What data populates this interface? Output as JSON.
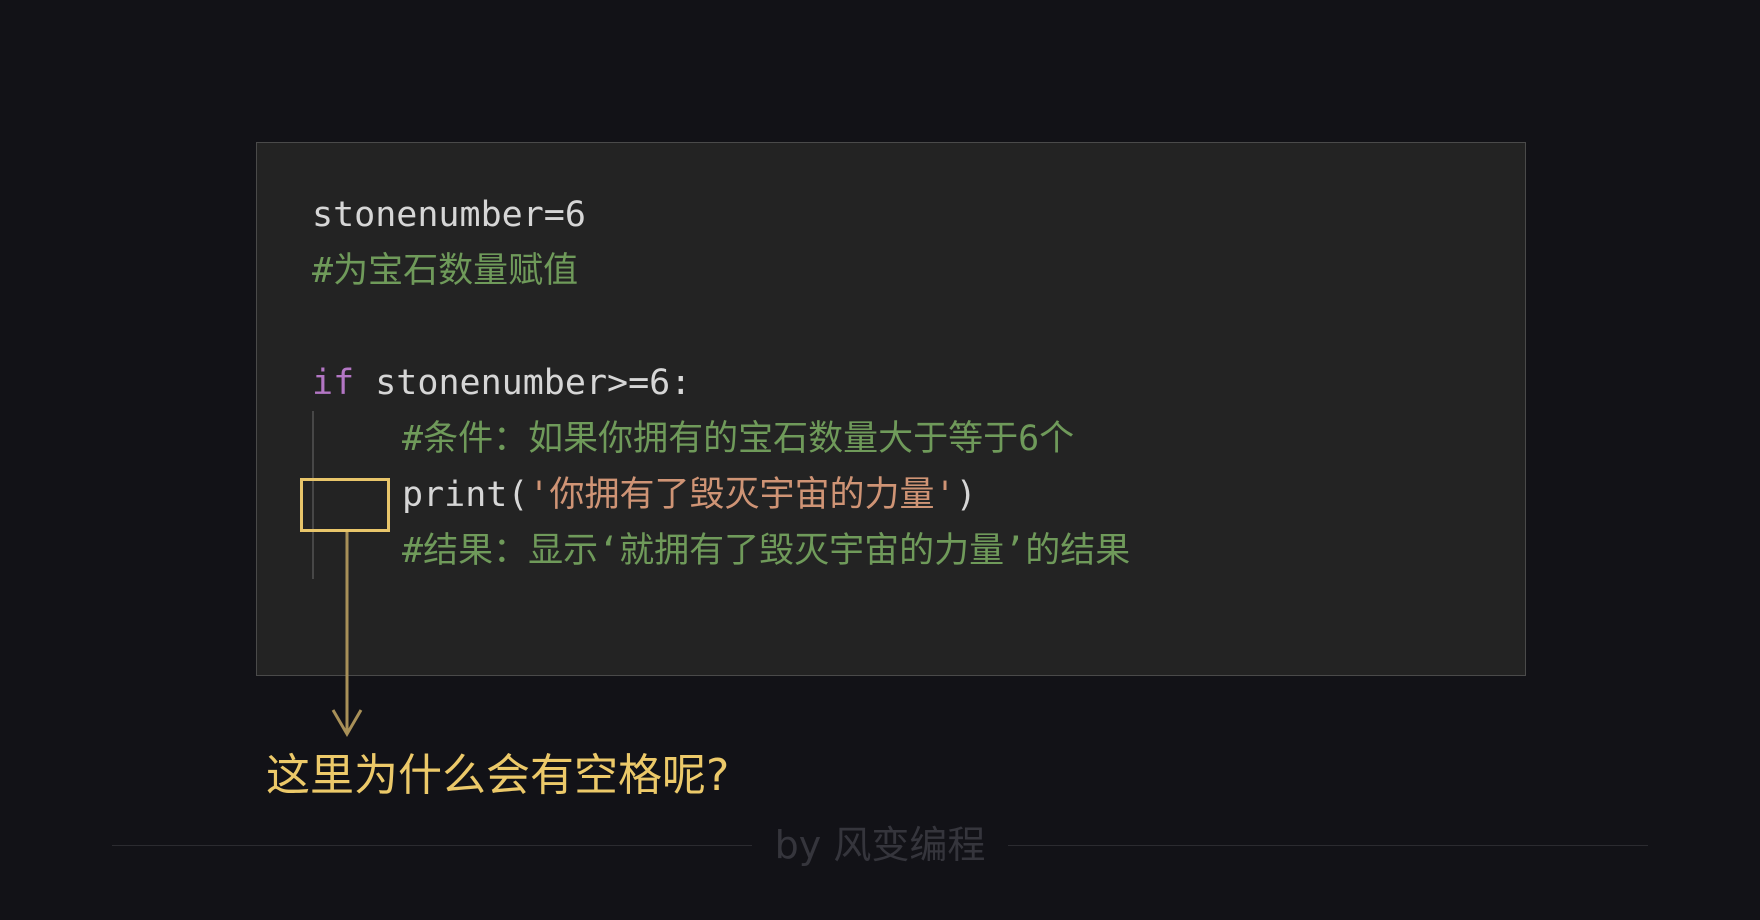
{
  "code": {
    "line1": "stonenumber=6",
    "line2": "#为宝石数量赋值",
    "line4_keyword": "if",
    "line4_rest": " stonenumber>=6:",
    "line5": "#条件：如果你拥有的宝石数量大于等于6个",
    "line6_func": "print(",
    "line6_string": "'你拥有了毁灭宇宙的力量'",
    "line6_close": ")",
    "line7": "#结果：显示‘就拥有了毁灭宇宙的力量’的结果"
  },
  "annotation": {
    "question": "这里为什么会有空格呢?"
  },
  "footer": {
    "credit": "by 风变编程"
  },
  "colors": {
    "background": "#121217",
    "code_background": "#232323",
    "plain_text": "#d6d6d6",
    "comment": "#6f9a5a",
    "keyword": "#b376c4",
    "string": "#cf9475",
    "accent": "#e8c56a",
    "question_text": "#ecc969"
  }
}
